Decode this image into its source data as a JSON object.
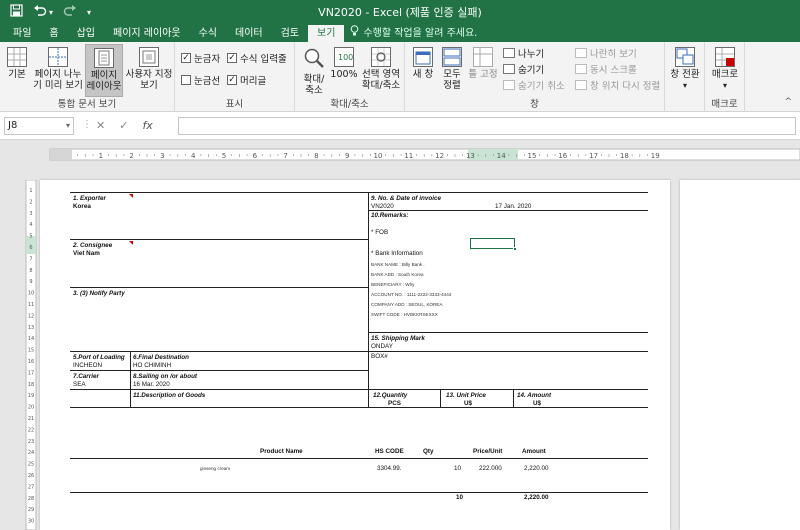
{
  "window": {
    "title": "VN2020 - Excel (제품 인증 실패)",
    "quick_access": {
      "save_icon": "save-icon",
      "undo_icon": "undo-icon",
      "undo_dropdown": "▾",
      "redo_icon": "redo-icon",
      "customize": "▾"
    }
  },
  "tabs": [
    {
      "label": "파일"
    },
    {
      "label": "홈"
    },
    {
      "label": "삽입"
    },
    {
      "label": "페이지 레이아웃"
    },
    {
      "label": "수식"
    },
    {
      "label": "데이터"
    },
    {
      "label": "검토"
    },
    {
      "label": "보기"
    }
  ],
  "active_tab": "보기",
  "tellme": "수행할 작업을 알려 주세요.",
  "ribbon": {
    "workbook_views": {
      "label": "통합 문서 보기",
      "normal": "기본",
      "page_break_1": "페이지 나누",
      "page_break_2": "기 미리 보기",
      "page_layout_1": "페이지",
      "page_layout_2": "레이아웃",
      "custom_1": "사용자 지정",
      "custom_2": "보기"
    },
    "show": {
      "label": "표시",
      "ruler": "눈금자",
      "formula_bar": "수식 입력줄",
      "gridlines": "눈금선",
      "headings": "머리글",
      "ruler_checked": true,
      "formula_bar_checked": true,
      "gridlines_checked": false,
      "headings_checked": true
    },
    "zoom": {
      "label": "확대/축소",
      "zoom_1": "확대/",
      "zoom_2": "축소",
      "hundred": "100%",
      "sel_1": "선택 영역",
      "sel_2": "확대/축소"
    },
    "window": {
      "label": "창",
      "new_window": "새 창",
      "arrange_1": "모두",
      "arrange_2": "정렬",
      "freeze": "틀 고정",
      "split": "나누기",
      "hide": "숨기기",
      "unhide": "숨기기 취소",
      "side_by_side": "나란히 보기",
      "sync_scroll": "동시 스크롤",
      "reset_pos": "창 위치 다시 정렬",
      "switch_1": "창 전환",
      "switch_dd": "▾"
    },
    "macros": {
      "label": "매크로",
      "btn": "매크로",
      "dd": "▾"
    }
  },
  "formula_bar": {
    "name_box": "J8",
    "cancel": "✕",
    "enter": "✓",
    "fx": "fx",
    "value": ""
  },
  "ruler": {
    "h_numbers": [
      "1",
      "2",
      "3",
      "4",
      "5",
      "6",
      "7",
      "8",
      "9",
      "10",
      "11",
      "12",
      "13",
      "14",
      "15",
      "16",
      "17",
      "18",
      "19"
    ],
    "v_numbers": [
      "1",
      "2",
      "3",
      "4",
      "5",
      "6",
      "7",
      "8",
      "9",
      "10",
      "11",
      "12",
      "13",
      "14",
      "15",
      "16",
      "17",
      "18",
      "19",
      "20",
      "21",
      "22",
      "23",
      "24",
      "25",
      "26",
      "27",
      "28",
      "29",
      "30"
    ]
  },
  "invoice": {
    "exporter_label": "1. Exporter",
    "exporter_value": "Korea",
    "consignee_label": "2. Consignee",
    "consignee_value": "Viet Nam",
    "notify_label": "3. (3) Notify Party",
    "port_loading_label": "5.Port of Loading",
    "port_loading_value": "INCHEON",
    "final_dest_label": "6.Final Destination",
    "final_dest_value": "HO CHIMINH",
    "carrier_label": "7.Carrier",
    "carrier_value": "SEA",
    "sailing_label": "8.Sailing on /or about",
    "sailing_value": "16 Mar. 2020",
    "desc_label": "11.Description of Goods",
    "invoice_no_label": "9. No. & Date of invoice",
    "invoice_no_value": "VN2020",
    "invoice_date": "17 Jan. 2020",
    "remarks_label": "10.Remarks:",
    "fob": "* FOB",
    "bank_info": "* Bank Information",
    "bank_name": "BANK NAME : Billy Bank .",
    "bank_add": "BANK ADD : South Korea",
    "beneficiary": "BENEFICIARY : Why",
    "account_no": "ACCOUNT NO. : 1111-2222-3333-4444",
    "company_add": "COMPANY ADD : SEOUL, KOREA",
    "swift": "SWIFT CODE : HVBKKRSEXXX",
    "shipping_label": "15. Shipping Mark",
    "shipping_1": "ONDAY",
    "shipping_2": "BOX#",
    "qty_label": "12.Quantity",
    "qty_unit": "PCS",
    "unit_price_label": "13. Unit Price",
    "unit_price_unit": "U$",
    "amount_label": "14. Amount",
    "amount_unit": "U$",
    "table_headers": [
      "Product Name",
      "HS CODE",
      "Qty",
      "Price/Unit",
      "Amount"
    ],
    "rows": [
      {
        "product": "ginseng cream",
        "hs": "3304.99.",
        "qty": "10",
        "price": "222.000",
        "amount": "2,220.00"
      }
    ],
    "total_qty": "10",
    "total_amount": "2,220.00"
  }
}
